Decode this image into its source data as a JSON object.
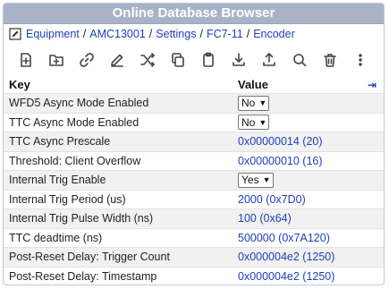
{
  "title": "Online Database Browser",
  "breadcrumb": [
    "Equipment",
    "AMC13001",
    "Settings",
    "FC7-11",
    "Encoder"
  ],
  "toolbar": [
    "add-file-icon",
    "add-folder-icon",
    "link-icon",
    "pencil-icon",
    "shuffle-icon",
    "copy-icon",
    "clipboard-icon",
    "download-icon",
    "upload-icon",
    "search-icon",
    "trash-icon",
    "more-icon"
  ],
  "table": {
    "col_key": "Key",
    "col_value": "Value",
    "collapse_glyph": "⇥",
    "rows": [
      {
        "key": "WFD5 Async Mode Enabled",
        "value": "No",
        "type": "select"
      },
      {
        "key": "TTC Async Mode Enabled",
        "value": "No",
        "type": "select"
      },
      {
        "key": "TTC Async Prescale",
        "value": "0x00000014 (20)",
        "type": "text"
      },
      {
        "key": "Threshold: Client Overflow",
        "value": "0x00000010 (16)",
        "type": "text"
      },
      {
        "key": "Internal Trig Enable",
        "value": "Yes",
        "type": "select"
      },
      {
        "key": "Internal Trig Period (us)",
        "value": "2000 (0x7D0)",
        "type": "text"
      },
      {
        "key": "Internal Trig Pulse Width (ns)",
        "value": "100 (0x64)",
        "type": "text"
      },
      {
        "key": "TTC deadtime (ns)",
        "value": "500000 (0x7A120)",
        "type": "text"
      },
      {
        "key": "Post-Reset Delay: Trigger Count",
        "value": "0x000004e2 (1250)",
        "type": "text"
      },
      {
        "key": "Post-Reset Delay: Timestamp",
        "value": "0x000004e2 (1250)",
        "type": "text"
      }
    ]
  },
  "colors": {
    "titlebar": "#a9b3c8",
    "link": "#1f3fbf",
    "row_alt": "#f1f1f1"
  }
}
